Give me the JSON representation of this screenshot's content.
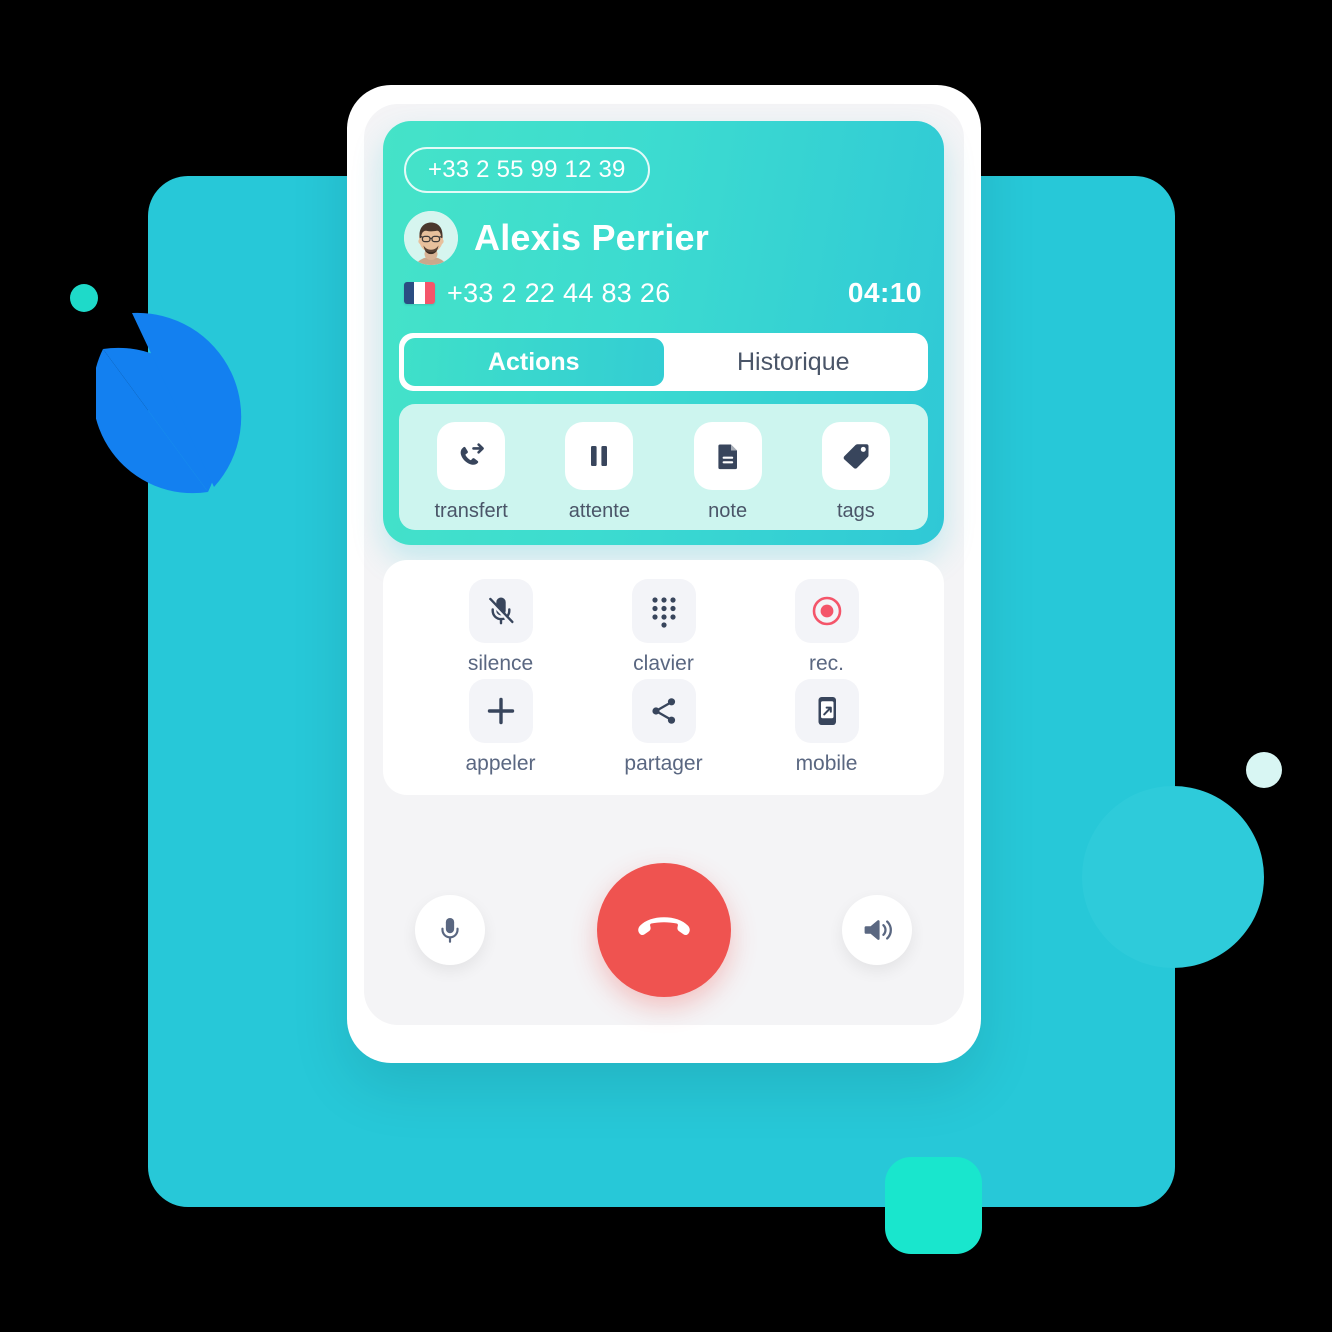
{
  "background": {
    "rect_color": "#27c8d8",
    "circle_color": "#2ecbda",
    "blue_shape_color": "#1380f0",
    "green_square_color": "#19e6cd",
    "pale_dot_color": "#d8f6f3",
    "teal_dot_color": "#1edac9"
  },
  "call": {
    "line_number": "+33 2 55 99 12 39",
    "contact_name": "Alexis Perrier",
    "contact_number": "+33 2 22 44 83 26",
    "duration": "04:10",
    "country_flag": "france-flag-icon",
    "avatar": "contact-avatar",
    "gradient_from": "#45e3c8",
    "gradient_to": "#2fc8d6"
  },
  "tabs": [
    {
      "label": "Actions",
      "active": true
    },
    {
      "label": "Historique",
      "active": false
    }
  ],
  "actions": [
    {
      "label": "transfert",
      "icon": "call-transfer-icon"
    },
    {
      "label": "attente",
      "icon": "pause-icon"
    },
    {
      "label": "note",
      "icon": "document-note-icon"
    },
    {
      "label": "tags",
      "icon": "tag-icon"
    }
  ],
  "functions": [
    {
      "label": "silence",
      "icon": "microphone-muted-icon"
    },
    {
      "label": "clavier",
      "icon": "dialpad-icon"
    },
    {
      "label": "rec.",
      "icon": "record-icon",
      "color": "#f4556a"
    },
    {
      "label": "appeler",
      "icon": "plus-icon"
    },
    {
      "label": "partager",
      "icon": "share-icon"
    },
    {
      "label": "mobile",
      "icon": "mobile-transfer-icon"
    }
  ],
  "bottom_bar": {
    "mic_icon": "microphone-icon",
    "hangup_icon": "hangup-phone-icon",
    "speaker_icon": "speaker-icon",
    "hangup_color": "#ef5350"
  }
}
